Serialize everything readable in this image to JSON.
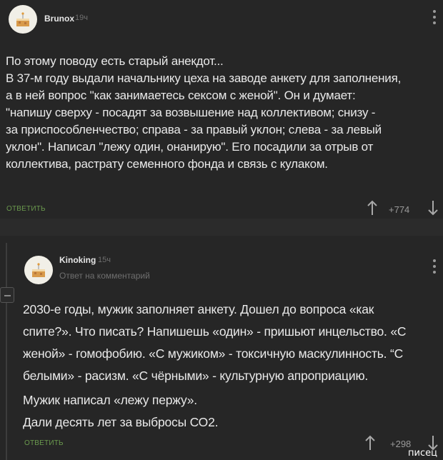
{
  "comment1": {
    "username": "Brunox",
    "time": "19ч",
    "text": [
      "По этому поводу есть старый анекдот...",
      "В 37-м году выдали начальнику цеха на заводе анкету для заполнения,",
      "а в ней вопрос \"как занимаетесь сексом с женой\". Он и думает:",
      "\"напишу сверху - посадят за возвышение над коллективом; снизу -",
      "за приспособленчество; справа - за правый уклон; слева - за левый",
      "уклон\". Написал \"лежу один, онанирую\". Его посадили за отрыв от",
      "коллектива, растрату семенного фонда и связь с кулаком."
    ],
    "reply_label": "ОТВЕТИТЬ",
    "rating": "+774"
  },
  "comment2": {
    "username": "Kinoking",
    "time": "15ч",
    "subline": "Ответ на комментарий",
    "text": [
      "2030-е годы, мужик заполняет анкету. Дошел до вопроса «как",
      "спите?». Что писать? Напишешь «один» - пришьют инцельство. «С",
      "женой» - гомофобию. «С мужиком» - токсичную маскулинность. “С",
      "белыми» - расизм. «С чёрными» - культурную апроприацию.",
      "Мужик написал «лежу пержу».",
      "Дали десять лет за выбросы СО2."
    ],
    "reply_label": "ОТВЕТИТЬ",
    "rating": "+298"
  },
  "watermark": "писец",
  "colors": {
    "background": "#262626",
    "text": "#e9e9e9",
    "reply": "#6b9a4e",
    "muted": "#6f6f6f"
  },
  "icons": [
    "avatar-cake-icon",
    "more-dots-icon",
    "upvote-arrow-icon",
    "downvote-arrow-icon",
    "collapse-thread-icon"
  ]
}
